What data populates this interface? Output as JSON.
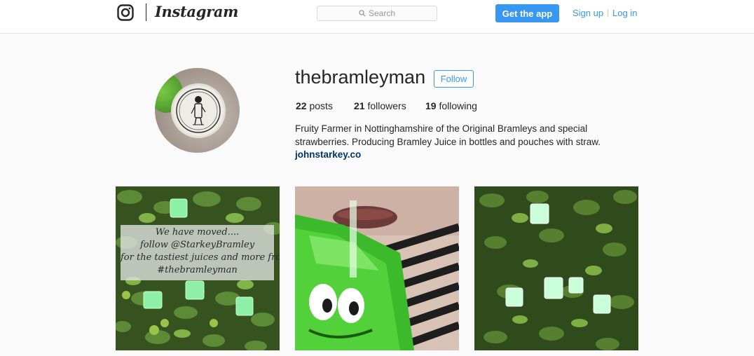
{
  "header": {
    "wordmark": "Instagram",
    "search_placeholder": "Search",
    "get_app_label": "Get the app",
    "signup_label": "Sign up",
    "separator": "|",
    "login_label": "Log in"
  },
  "profile": {
    "username": "thebramleyman",
    "follow_label": "Follow",
    "stats": {
      "posts_count": "22",
      "posts_label": "posts",
      "followers_count": "21",
      "followers_label": "followers",
      "following_count": "19",
      "following_label": "following"
    },
    "bio_line1": "Fruity Farmer in Nottinghamshire of the Original Bramleys and special",
    "bio_line2": "strawberries. Producing Bramley Juice in bottles and pouches with straw.",
    "website": "johnstarkey.co"
  },
  "posts": {
    "post1_overlay": [
      "We have moved....",
      "follow @StarkeyBramley",
      "for the tastiest juices and more from",
      "#thebramleyman"
    ]
  },
  "colors": {
    "accent": "#3897f0",
    "link_dark": "#003569",
    "text": "#262626",
    "background": "#fafafa"
  },
  "icons": {
    "logo": "instagram-camera-icon",
    "search": "search-icon"
  }
}
